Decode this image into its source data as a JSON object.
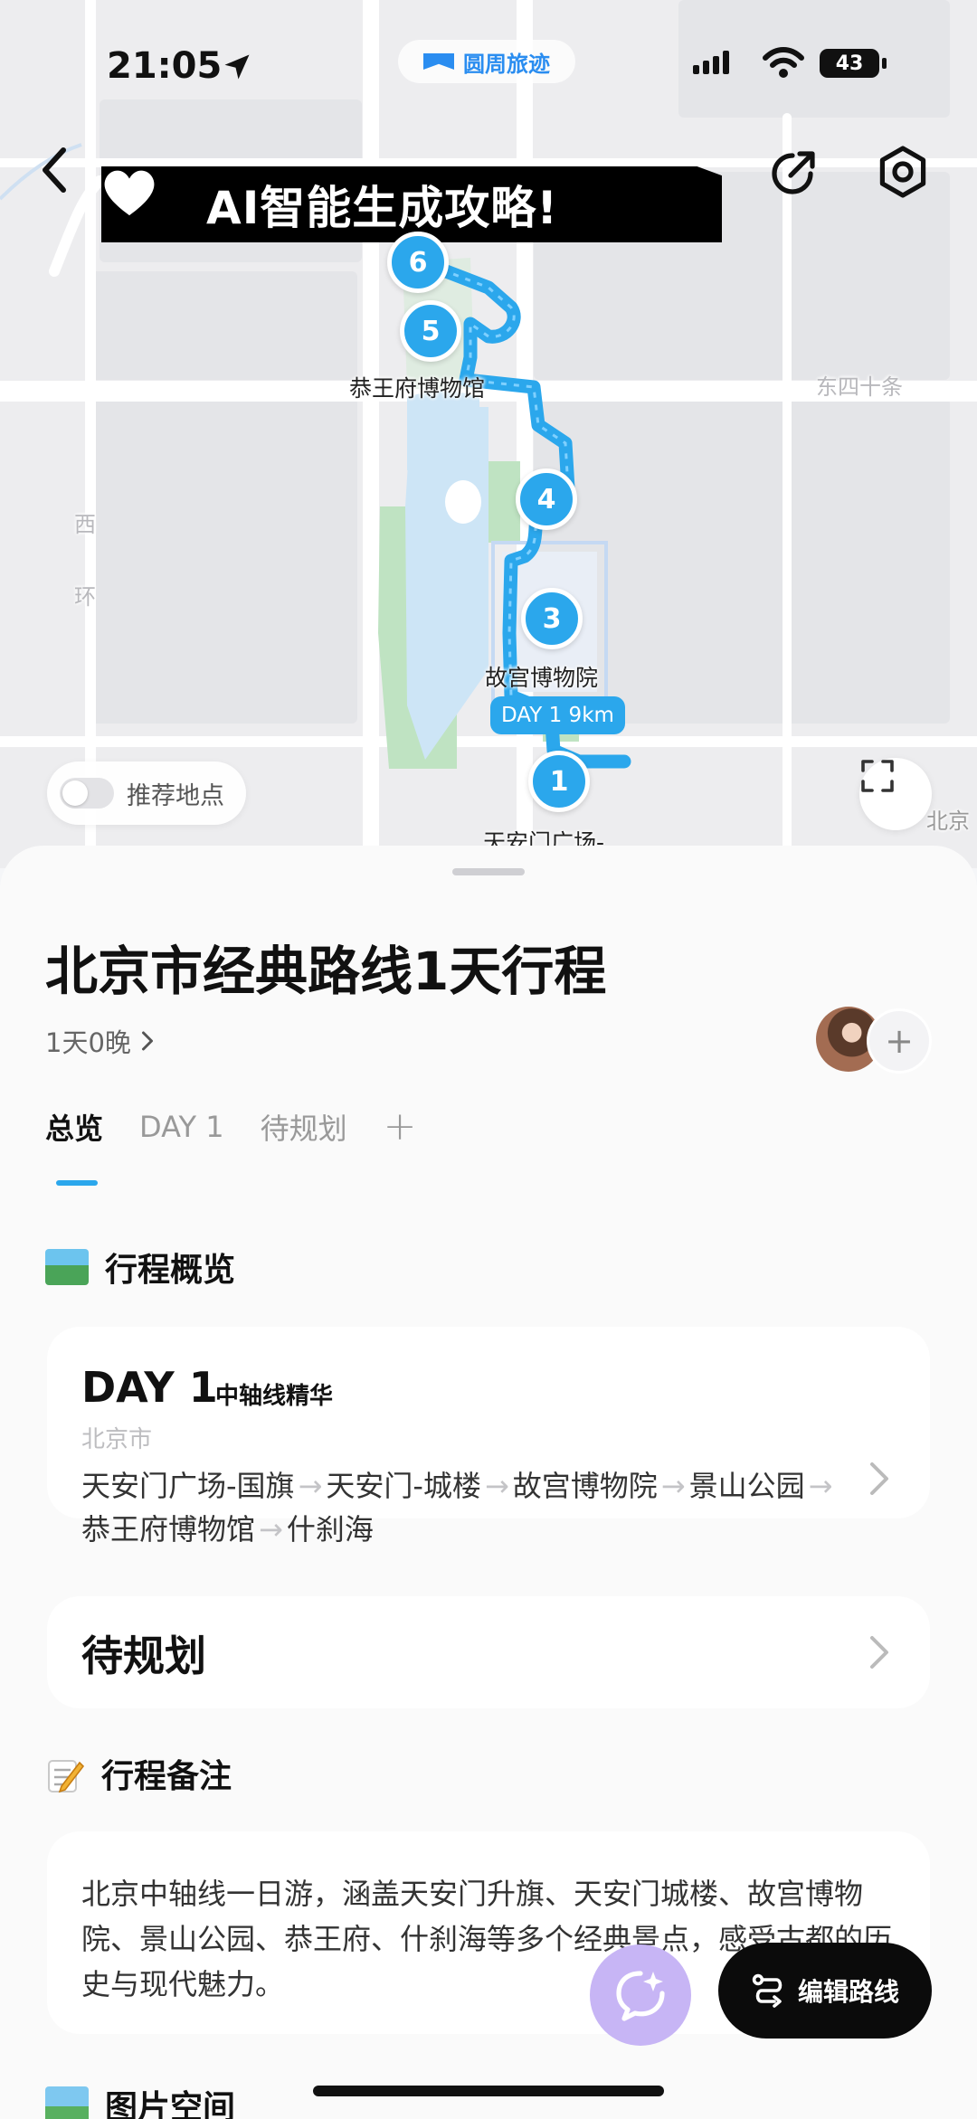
{
  "status_bar": {
    "time": "21:05",
    "app_name": "圆周旅迹",
    "battery": "43"
  },
  "map": {
    "banner_text": "AI智能生成攻略!",
    "pins": [
      "1",
      "3",
      "4",
      "5",
      "6"
    ],
    "labels": {
      "prince_gong": "恭王府博物馆",
      "palace_museum": "故宫博物院",
      "tiananmen": "天安门广场-",
      "street_east": "东四十条",
      "street_west": "西",
      "street_west2": "环",
      "edge_beijing": "北京"
    },
    "distance_badge": "DAY 1 9km",
    "recommend_toggle_label": "推荐地点",
    "recommend_on": false,
    "route_color": "#2ba7ec"
  },
  "trip": {
    "title": "北京市经典路线1天行程",
    "duration": "1天0晚",
    "tabs": [
      "总览",
      "DAY 1",
      "待规划"
    ],
    "active_tab": "总览"
  },
  "overview": {
    "heading": "行程概览",
    "day_card": {
      "day": "DAY 1",
      "theme": "中轴线精华",
      "city": "北京市",
      "stops": [
        "天安门广场-国旗",
        "天安门-城楼",
        "故宫博物院",
        "景山公园",
        "恭王府博物馆",
        "什刹海"
      ]
    },
    "pending_label": "待规划"
  },
  "notes": {
    "heading": "行程备注",
    "text": "北京中轴线一日游，涵盖天安门升旗、天安门城楼、故宫博物院、景山公园、恭王府、什刹海等多个经典景点，感受古都的历史与现代魅力。"
  },
  "gallery": {
    "heading": "图片空间"
  },
  "actions": {
    "edit_route": "编辑路线"
  }
}
